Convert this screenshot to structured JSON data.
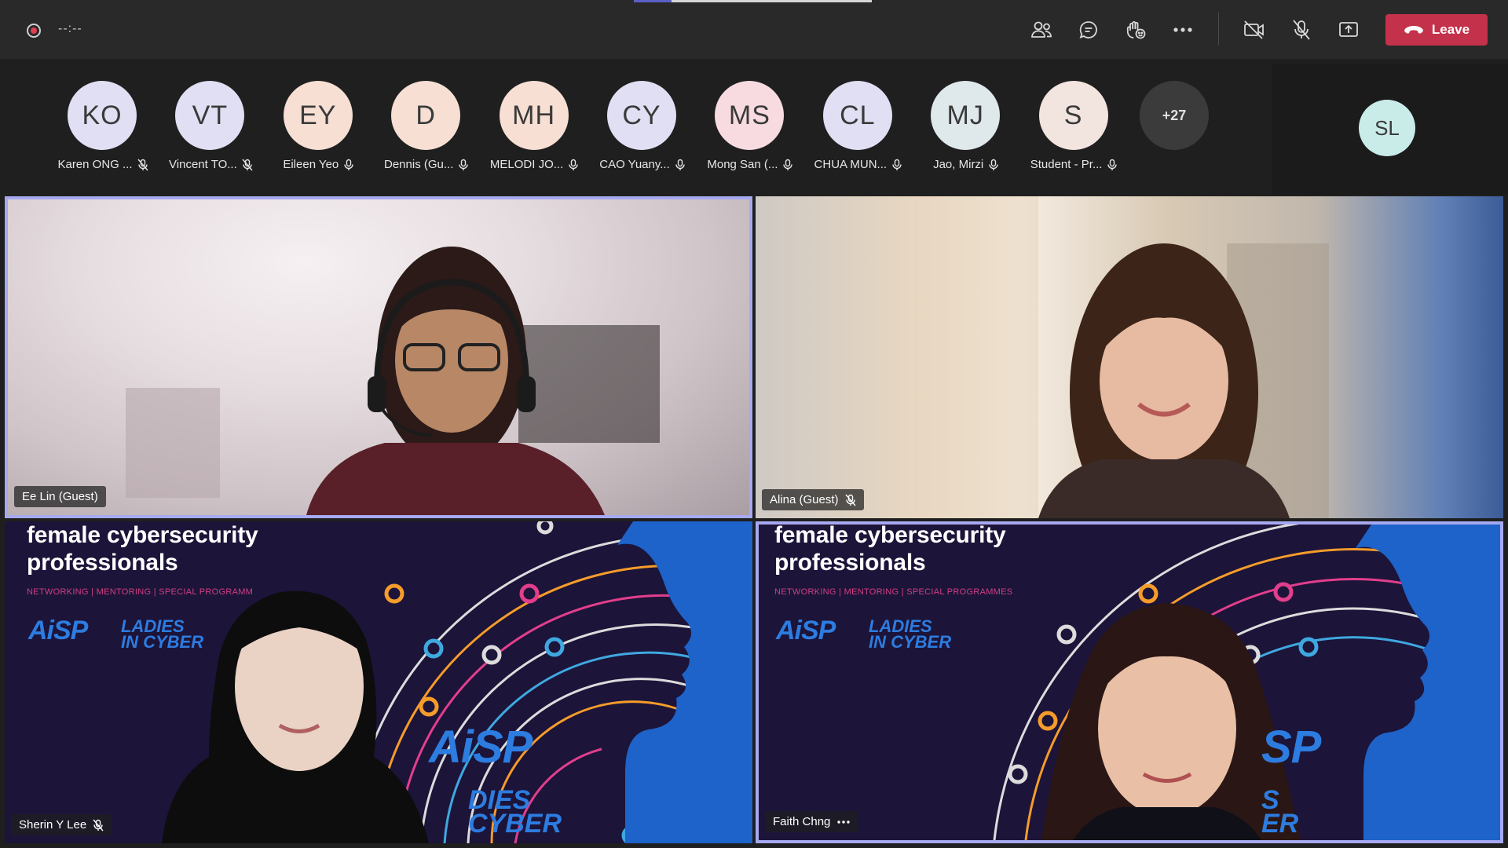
{
  "toolbar": {
    "timer": "--:--",
    "progress_fraction": 0.16,
    "leave_label": "Leave",
    "icons": [
      "people-icon",
      "chat-icon",
      "reactions-icon",
      "more-icon",
      "camera-off-icon",
      "mic-off-icon",
      "share-icon"
    ]
  },
  "roster": {
    "participants": [
      {
        "initials": "KO",
        "name": "Karen ONG ...",
        "color": "#e1dff3",
        "mic": "muted"
      },
      {
        "initials": "VT",
        "name": "Vincent TO...",
        "color": "#e1dff3",
        "mic": "muted"
      },
      {
        "initials": "EY",
        "name": "Eileen Yeo",
        "color": "#f7dfd4",
        "mic": "on"
      },
      {
        "initials": "D",
        "name": "Dennis (Gu...",
        "color": "#f7dfd4",
        "mic": "on"
      },
      {
        "initials": "MH",
        "name": "MELODI JO...",
        "color": "#f7dfd4",
        "mic": "on"
      },
      {
        "initials": "CY",
        "name": "CAO Yuany...",
        "color": "#e1dff3",
        "mic": "on"
      },
      {
        "initials": "MS",
        "name": "Mong San (...",
        "color": "#f7dbe1",
        "mic": "on"
      },
      {
        "initials": "CL",
        "name": "CHUA MUN...",
        "color": "#e1dff3",
        "mic": "on"
      },
      {
        "initials": "MJ",
        "name": "Jao, Mirzi",
        "color": "#dfe8eb",
        "mic": "on"
      },
      {
        "initials": "S",
        "name": "Student - Pr...",
        "color": "#f2e4df",
        "mic": "on"
      }
    ],
    "overflow_label": "+27",
    "self_initials": "SL"
  },
  "tiles": {
    "top_left": {
      "name": "Ee Lin (Guest)"
    },
    "top_right": {
      "name": "Alina (Guest)"
    },
    "bottom_left": {
      "name": "Sherin Y Lee",
      "slide_title_1": "female cybersecurity",
      "slide_title_2": "professionals",
      "slide_sub": "NETWORKING | MENTORING | SPECIAL PROGRAMM",
      "logo_1": "AiSP",
      "logo_2a": "LADIES",
      "logo_2b": "IN CYBER",
      "big_logo": "AiSP",
      "big_text_a": "DIES",
      "big_text_b": "CYBER"
    },
    "bottom_right": {
      "name": "Faith Chng",
      "slide_title_1": "female cybersecurity",
      "slide_title_2": "professionals",
      "slide_sub": "NETWORKING | MENTORING | SPECIAL PROGRAMMES",
      "logo_1": "AiSP",
      "logo_2a": "LADIES",
      "logo_2b": "IN CYBER",
      "big_logo": "SP",
      "big_text_a": "S",
      "big_text_b": "ER"
    }
  }
}
